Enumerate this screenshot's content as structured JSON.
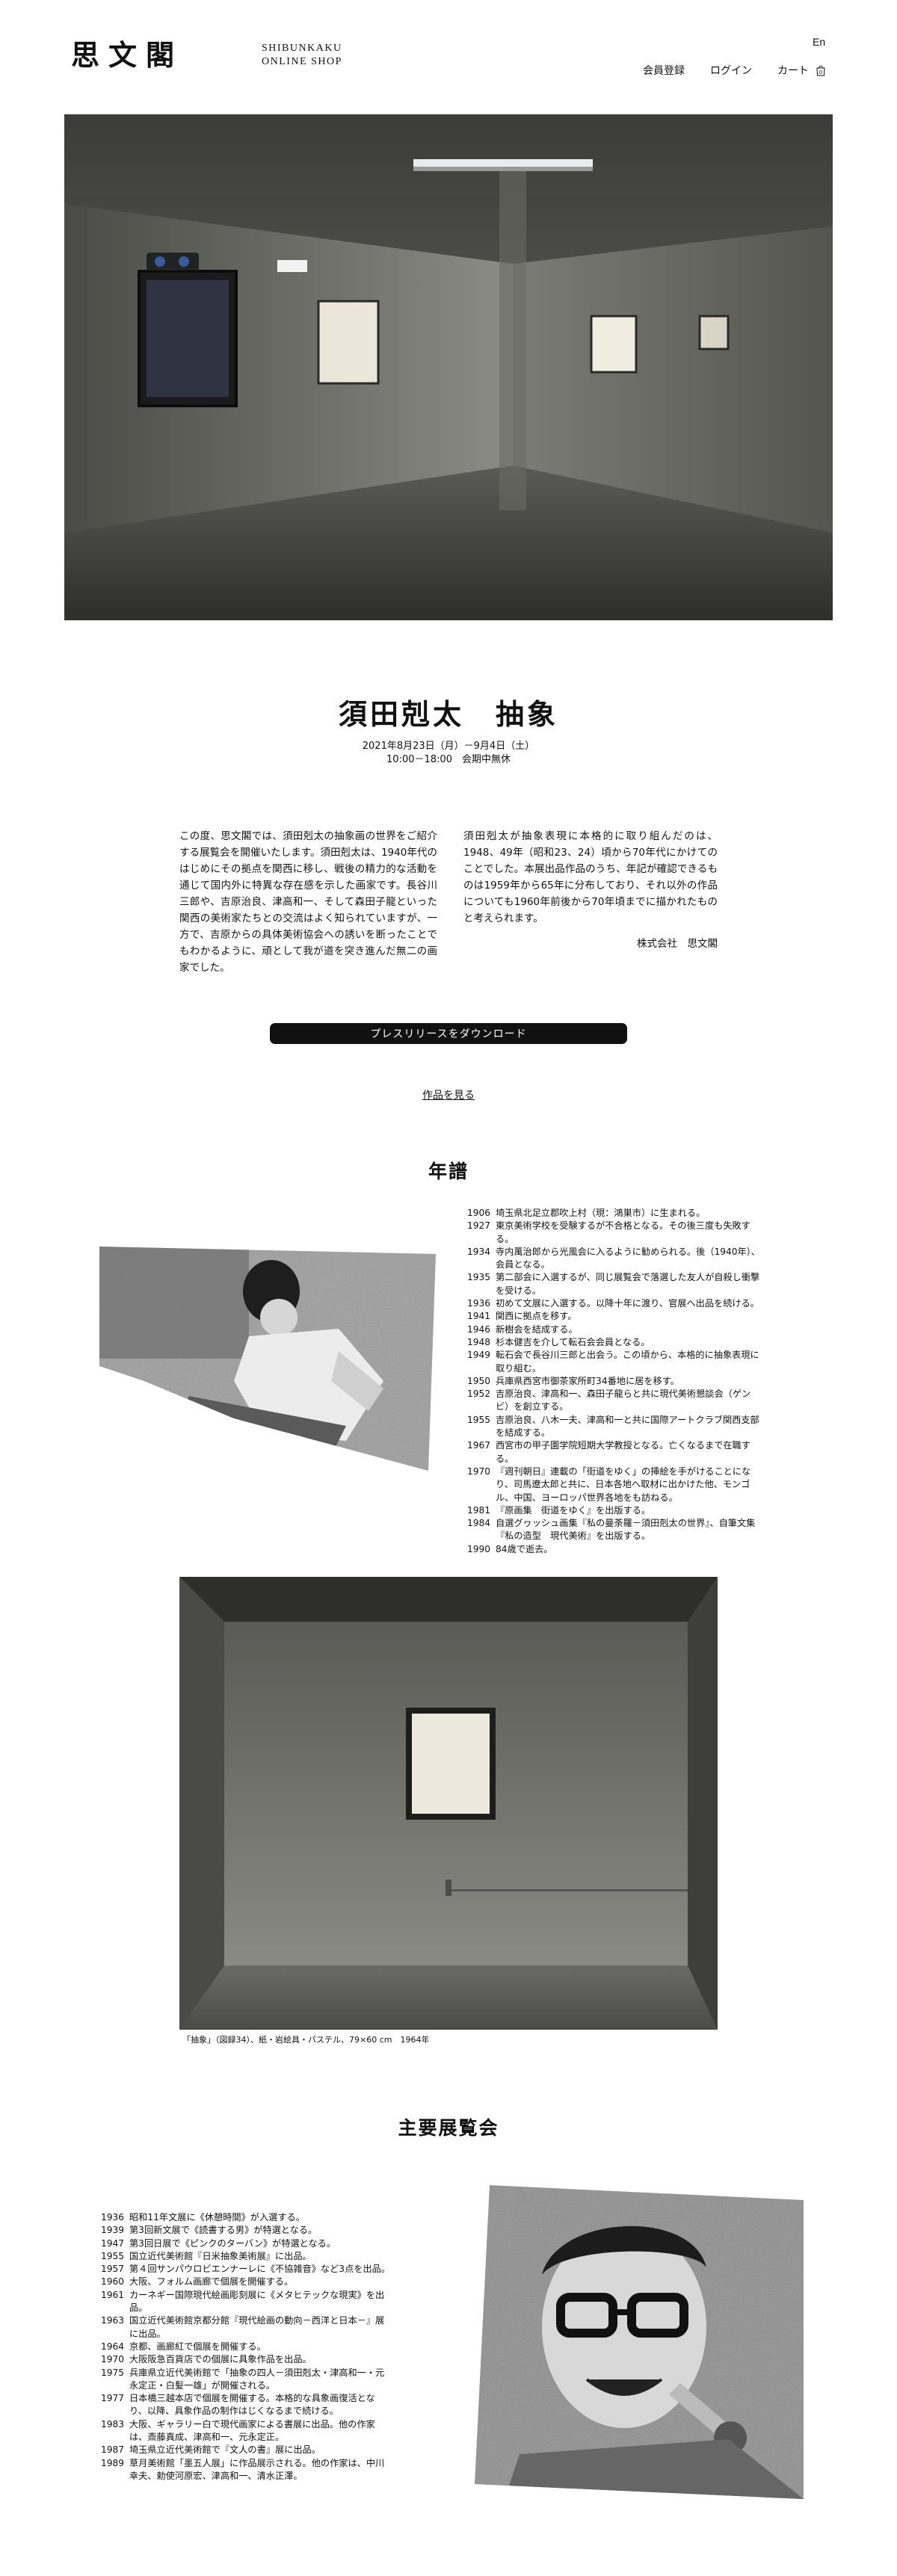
{
  "header": {
    "logo_text": "思文閣",
    "brand_line1": "SHIBUNKAKU",
    "brand_line2": "ONLINE SHOP",
    "lang": "En",
    "nav": {
      "register": "会員登録",
      "login": "ログイン",
      "cart": "カート"
    },
    "cart_count": "0"
  },
  "exhibition": {
    "title": "須田剋太　抽象",
    "date": "2021年8月23日（月）－9月4日（土）",
    "hours": "10:00－18:00　会期中無休",
    "intro_left": "この度、思文閣では、須田剋太の抽象画の世界をご紹介する展覧会を開催いたします。須田剋太は、1940年代のはじめにその拠点を関西に移し、戦後の精力的な活動を通じて国内外に特異な存在感を示した画家です。長谷川三郎や、吉原治良、津高和一、そして森田子龍といった関西の美術家たちとの交流はよく知られていますが、一方で、吉原からの具体美術協会への誘いを断ったことでもわかるように、頑として我が道を突き進んだ無二の画家でした。",
    "intro_right": "須田剋太が抽象表現に本格的に取り組んだのは、1948、49年（昭和23、24）頃から70年代にかけてのことでした。本展出品作品のうち、年記が確認できるものは1959年から65年に分布しており、それ以外の作品についても1960年前後から70年頃までに描かれたものと考えられます。",
    "signature": "株式会社　思文閣",
    "download_label": "プレスリリースをダウンロード",
    "works_link": "作品を見る"
  },
  "chronology": {
    "title": "年譜",
    "entries": [
      {
        "year": "1906",
        "text": "埼玉県北足立郡吹上村（現：鴻巣市）に生まれる。"
      },
      {
        "year": "1927",
        "text": "東京美術学校を受験するが不合格となる。その後三度も失敗する。"
      },
      {
        "year": "1934",
        "text": "寺内萬治郎から光風会に入るように勧められる。後（1940年）、会員となる。"
      },
      {
        "year": "1935",
        "text": "第二部会に入選するが、同じ展覧会で落選した友人が自殺し衝撃を受ける。"
      },
      {
        "year": "1936",
        "text": "初めて文展に入選する。以降十年に渡り、官展へ出品を続ける。"
      },
      {
        "year": "1941",
        "text": "関西に拠点を移す。"
      },
      {
        "year": "1946",
        "text": "新樹会を結成する。"
      },
      {
        "year": "1948",
        "text": "杉本健吉を介して転石会会員となる。"
      },
      {
        "year": "1949",
        "text": "転石会で長谷川三郎と出会う。この頃から、本格的に抽象表現に取り組む。"
      },
      {
        "year": "1950",
        "text": "兵庫県西宮市御茶家所町34番地に居を移す。"
      },
      {
        "year": "1952",
        "text": "吉原治良、津高和一、森田子龍らと共に現代美術懇談会（ゲンビ）を創立する。"
      },
      {
        "year": "1955",
        "text": "吉原治良、八木一夫、津高和一と共に国際アートクラブ関西支部を結成する。"
      },
      {
        "year": "1967",
        "text": "西宮市の甲子園学院短期大学教授となる。亡くなるまで在職する。"
      },
      {
        "year": "1970",
        "text": "『週刊朝日』連載の「街道をゆく」の挿絵を手がけることになり、司馬遼太郎と共に、日本各地へ取材に出かけた他、モンゴル、中国、ヨーロッパ世界各地をも訪ねる。"
      },
      {
        "year": "1981",
        "text": "『原画集　街道をゆく』を出版する。"
      },
      {
        "year": "1984",
        "text": "自選グヮッシュ画集『私の曼荼羅－須田剋太の世界』、自筆文集『私の造型　現代美術』を出版する。"
      },
      {
        "year": "1990",
        "text": "84歳で逝去。"
      }
    ]
  },
  "artwork_caption": "「抽象」（図録34）、紙・岩絵具・パステル、79×60 cm　1964年",
  "exhibitions": {
    "title": "主要展覧会",
    "entries": [
      {
        "year": "1936",
        "text": "昭和11年文展に《休憩時間》が入選する。"
      },
      {
        "year": "1939",
        "text": "第3回新文展で《読書する男》が特選となる。"
      },
      {
        "year": "1947",
        "text": "第3回日展で《ピンクのターバン》が特選となる。"
      },
      {
        "year": "1955",
        "text": "国立近代美術館『日米抽象美術展』に出品。"
      },
      {
        "year": "1957",
        "text": "第４回サンパウロビエンナーレに《不協雑音》など3点を出品。"
      },
      {
        "year": "1960",
        "text": "大阪、フォルム画廊で個展を開催する。"
      },
      {
        "year": "1961",
        "text": "カーネギー国際現代絵画彫刻展に《メタヒテックな現実》を出品。"
      },
      {
        "year": "1963",
        "text": "国立近代美術館京都分館『現代絵画の動向－西洋と日本－』展に出品。"
      },
      {
        "year": "1964",
        "text": "京都、画廊紅で個展を開催する。"
      },
      {
        "year": "1970",
        "text": "大阪阪急百貨店での個展に具象作品を出品。"
      },
      {
        "year": "1975",
        "text": "兵庫県立近代美術館で「抽象の四人－須田剋太・津高和一・元永定正・白髪一雄」が開催される。"
      },
      {
        "year": "1977",
        "text": "日本橋三越本店で個展を開催する。本格的な具象画復活となり、以降、具象作品の制作はじくなるまで続ける。"
      },
      {
        "year": "1983",
        "text": "大阪、ギャラリー白で現代画家による書展に出品。他の作家は、斎藤真成、津高和一、元永定正。"
      },
      {
        "year": "1987",
        "text": "埼玉県立近代美術館で『文人の書』展に出品。"
      },
      {
        "year": "1989",
        "text": "草月美術館「墨五人展」に作品展示される。他の作家は、中川幸夫、勅使河原宏、津高和一、清水正澤。"
      }
    ]
  },
  "colors": {
    "text": "#111111",
    "button_bg": "#111111",
    "button_text": "#ffffff",
    "background": "#ffffff"
  }
}
